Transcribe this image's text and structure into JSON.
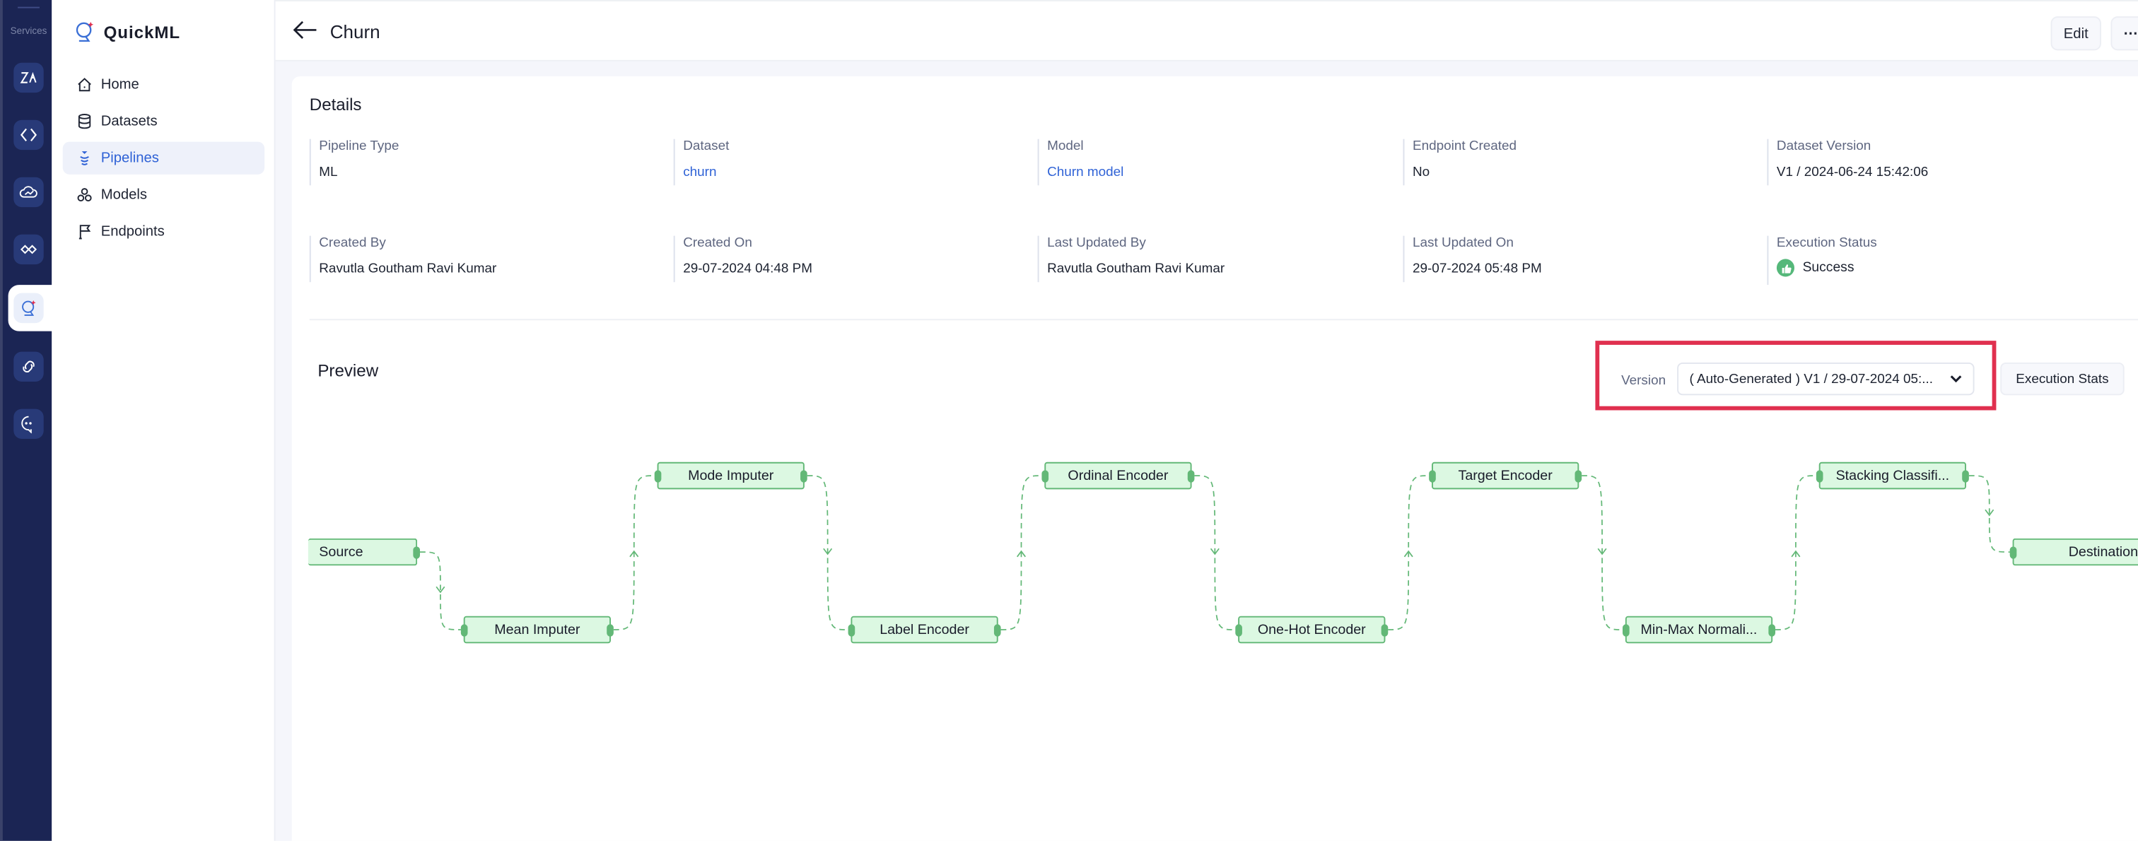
{
  "rail": {
    "title": "Services",
    "items": [
      {
        "name": "zia-icon"
      },
      {
        "name": "code-brackets-icon"
      },
      {
        "name": "cloud-analytics-icon"
      },
      {
        "name": "handshake-icon"
      },
      {
        "name": "quickml-icon",
        "active": true
      },
      {
        "name": "link-icon"
      },
      {
        "name": "chat-bot-icon"
      }
    ]
  },
  "sidebar": {
    "brand": "QuickML",
    "items": [
      {
        "label": "Home",
        "icon": "home-icon"
      },
      {
        "label": "Datasets",
        "icon": "database-icon"
      },
      {
        "label": "Pipelines",
        "icon": "pipeline-icon",
        "active": true
      },
      {
        "label": "Models",
        "icon": "models-icon"
      },
      {
        "label": "Endpoints",
        "icon": "flag-icon"
      }
    ]
  },
  "header": {
    "title": "Churn",
    "edit_label": "Edit",
    "more_label": "⋯"
  },
  "details": {
    "heading": "Details",
    "fields": [
      {
        "label": "Pipeline Type",
        "value": "ML"
      },
      {
        "label": "Dataset",
        "value": "churn",
        "link": true
      },
      {
        "label": "Model",
        "value": "Churn model",
        "link": true
      },
      {
        "label": "Endpoint Created",
        "value": "No"
      },
      {
        "label": "Dataset Version",
        "value": "V1 / 2024-06-24 15:42:06"
      },
      {
        "label": "Created By",
        "value": "Ravutla Goutham Ravi Kumar"
      },
      {
        "label": "Created On",
        "value": "29-07-2024 04:48 PM"
      },
      {
        "label": "Last Updated By",
        "value": "Ravutla Goutham Ravi Kumar"
      },
      {
        "label": "Last Updated On",
        "value": "29-07-2024 05:48 PM"
      },
      {
        "label": "Execution Status",
        "value": "Success"
      }
    ]
  },
  "preview": {
    "heading": "Preview",
    "version_label": "Version",
    "version_value": "( Auto-Generated ) V1 / 29-07-2024 05:...",
    "exec_stats_label": "Execution Stats",
    "nodes": [
      "Source",
      "Mean Imputer",
      "Mode Imputer",
      "Label Encoder",
      "Ordinal Encoder",
      "One-Hot Encoder",
      "Target Encoder",
      "Min-Max Normali...",
      "Stacking Classifi...",
      "Destination"
    ]
  },
  "colors": {
    "accent": "#2f62d6",
    "rail": "#1b2554",
    "node_fill": "#dcf8e2",
    "node_border": "#63b877",
    "highlight": "#e0304f",
    "success": "#55b87a"
  }
}
